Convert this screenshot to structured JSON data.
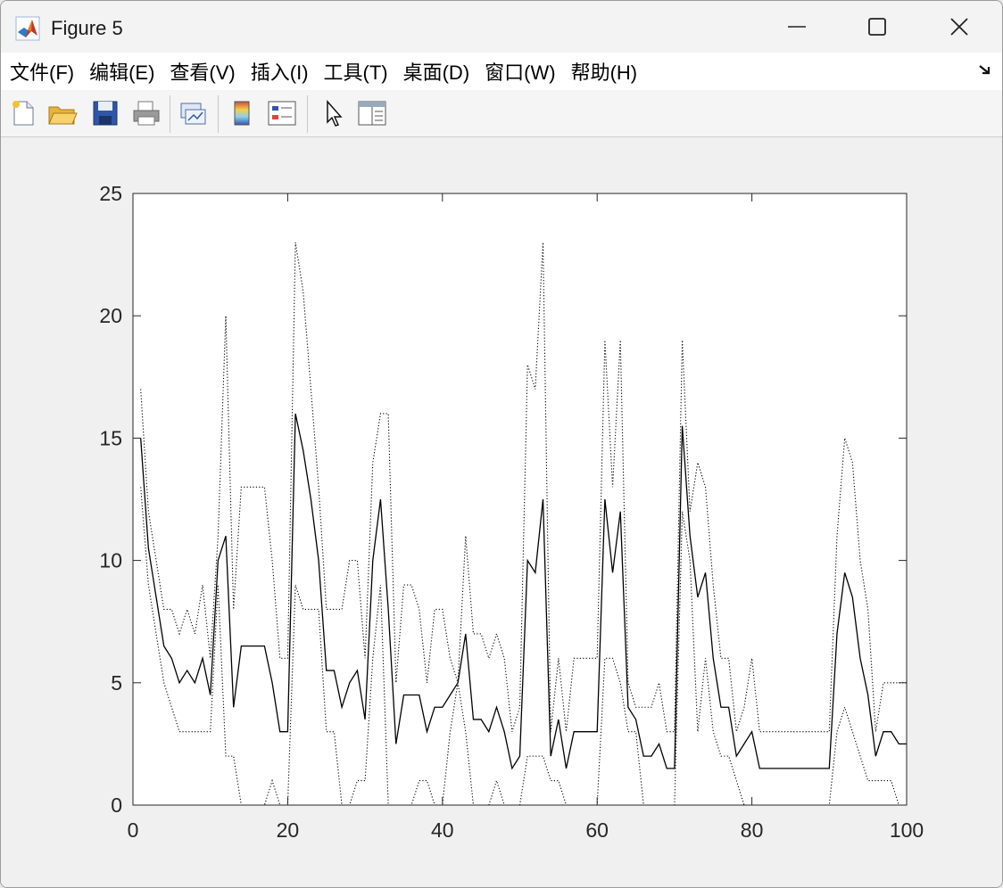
{
  "window": {
    "title": "Figure 5"
  },
  "menu": {
    "items": [
      "文件(F)",
      "编辑(E)",
      "查看(V)",
      "插入(I)",
      "工具(T)",
      "桌面(D)",
      "窗口(W)",
      "帮助(H)"
    ]
  },
  "toolbar": {
    "icons": [
      "new-figure-icon",
      "open-icon",
      "save-icon",
      "print-icon",
      "link-plot-icon",
      "colorbar-icon",
      "legend-icon",
      "pointer-icon",
      "property-inspector-icon"
    ]
  },
  "chart_data": {
    "type": "line",
    "title": "",
    "xlabel": "",
    "ylabel": "",
    "xlim": [
      0,
      100
    ],
    "ylim": [
      0,
      25
    ],
    "xticks": [
      0,
      20,
      40,
      60,
      80,
      100
    ],
    "yticks": [
      0,
      5,
      10,
      15,
      20,
      25
    ],
    "grid": false,
    "x": [
      1,
      2,
      3,
      4,
      5,
      6,
      7,
      8,
      9,
      10,
      11,
      12,
      13,
      14,
      15,
      16,
      17,
      18,
      19,
      20,
      21,
      22,
      23,
      24,
      25,
      26,
      27,
      28,
      29,
      30,
      31,
      32,
      33,
      34,
      35,
      36,
      37,
      38,
      39,
      40,
      41,
      42,
      43,
      44,
      45,
      46,
      47,
      48,
      49,
      50,
      51,
      52,
      53,
      54,
      55,
      56,
      57,
      58,
      59,
      60,
      61,
      62,
      63,
      64,
      65,
      66,
      67,
      68,
      69,
      70,
      71,
      72,
      73,
      74,
      75,
      76,
      77,
      78,
      79,
      80,
      81,
      82,
      83,
      84,
      85,
      86,
      87,
      88,
      89,
      90,
      91,
      92,
      93,
      94,
      95,
      96,
      97,
      98,
      99,
      100
    ],
    "series": [
      {
        "style": "solid",
        "values": [
          15,
          10.5,
          8.5,
          6.5,
          6,
          5,
          5.5,
          5,
          6,
          4.5,
          10,
          11,
          4,
          6.5,
          6.5,
          6.5,
          6.5,
          5,
          3,
          3,
          16,
          14.5,
          12.5,
          10,
          5.5,
          5.5,
          4,
          5,
          5.5,
          3.5,
          10,
          12.5,
          8,
          2.5,
          4.5,
          4.5,
          4.5,
          3,
          4,
          4,
          4.5,
          5,
          7,
          3.5,
          3.5,
          3,
          4,
          3,
          1.5,
          2,
          10,
          9.5,
          12.5,
          2,
          3.5,
          1.5,
          3,
          3,
          3,
          3,
          12.5,
          9.5,
          12,
          4,
          3.5,
          2,
          2,
          2.5,
          1.5,
          1.5,
          15.5,
          11,
          8.5,
          9.5,
          6,
          4,
          4,
          2,
          2.5,
          3,
          1.5,
          1.5,
          1.5,
          1.5,
          1.5,
          1.5,
          1.5,
          1.5,
          1.5,
          1.5,
          7,
          9.5,
          8.5,
          6,
          4.5,
          2,
          3,
          3,
          2.5,
          2.5
        ]
      },
      {
        "style": "dotted",
        "values": [
          17,
          12,
          10,
          8,
          8,
          7,
          8,
          7,
          9,
          6,
          11,
          20,
          8,
          13,
          13,
          13,
          13,
          10,
          6,
          6,
          23,
          21,
          17,
          13,
          8,
          8,
          8,
          10,
          10,
          6,
          14,
          16,
          16,
          5,
          9,
          9,
          8,
          5,
          8,
          8,
          6,
          5,
          11,
          7,
          7,
          6,
          7,
          6,
          3,
          4,
          18,
          17,
          23,
          3,
          6,
          3,
          6,
          6,
          6,
          6,
          19,
          13,
          19,
          5,
          4,
          4,
          4,
          5,
          3,
          3,
          19,
          12,
          14,
          13,
          9,
          6,
          6,
          3,
          4,
          6,
          3,
          3,
          3,
          3,
          3,
          3,
          3,
          3,
          3,
          3,
          11,
          15,
          14,
          10,
          8,
          3,
          5,
          5,
          5,
          5
        ]
      },
      {
        "style": "dotted",
        "values": [
          13,
          9,
          7,
          5,
          4,
          3,
          3,
          3,
          3,
          3,
          9,
          2,
          2,
          0,
          0,
          0,
          0,
          1,
          0,
          0,
          9,
          8,
          8,
          8,
          3,
          3,
          0,
          0,
          1,
          1,
          6,
          9,
          0,
          0,
          0,
          0,
          1,
          1,
          0,
          0,
          3,
          5,
          3,
          0,
          0,
          0,
          1,
          0,
          0,
          0,
          2,
          2,
          2,
          1,
          1,
          0,
          0,
          0,
          0,
          0,
          6,
          6,
          5,
          3,
          3,
          0,
          0,
          0,
          0,
          0,
          12,
          10,
          3,
          6,
          3,
          2,
          2,
          1,
          0,
          0,
          0,
          0,
          0,
          0,
          0,
          0,
          0,
          0,
          0,
          0,
          3,
          4,
          3,
          2,
          1,
          1,
          1,
          1,
          0,
          0
        ]
      }
    ]
  }
}
